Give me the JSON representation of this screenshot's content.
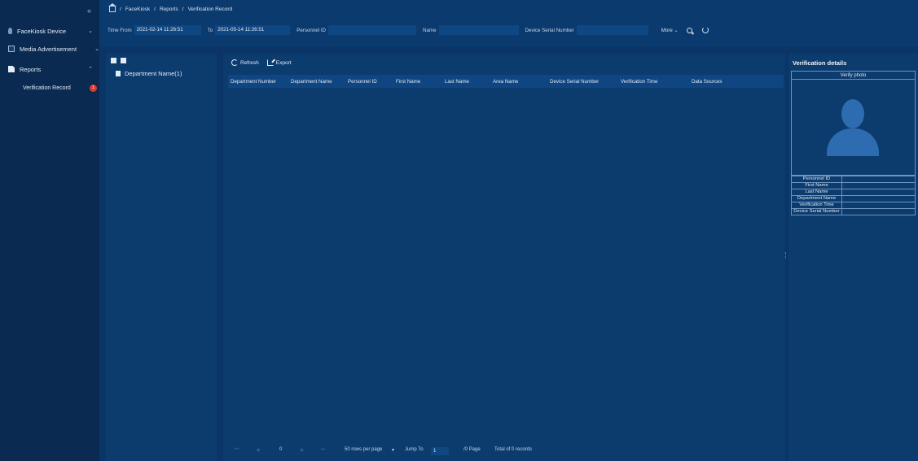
{
  "sidebar": {
    "collapse_glyph": "«",
    "items": [
      {
        "label": "FaceKiosk Device",
        "chevron": "⌄"
      },
      {
        "label": "Media Advertisement",
        "chevron": "⌄"
      },
      {
        "label": "Reports",
        "chevron": "⌃"
      }
    ],
    "sub_item": {
      "label": "Verification Record",
      "badge": "1"
    }
  },
  "breadcrumb": {
    "sep": "/",
    "items": [
      "FaceKiosk",
      "Reports",
      "Verification Record"
    ]
  },
  "filters": {
    "time_from_label": "Time From",
    "time_from_value": "2021-02-14 11:26:51",
    "to_label": "To",
    "to_value": "2021-05-14 11:26:51",
    "personnel_id_label": "Personnel ID",
    "name_label": "Name",
    "device_serial_label": "Device Serial Number",
    "more_label": "More ⌄"
  },
  "dept_tree": {
    "item": "Department Name(1)"
  },
  "toolbar": {
    "refresh_label": "Refresh",
    "export_label": "Export"
  },
  "table": {
    "columns": [
      "Department Number",
      "Department Name",
      "Personnel ID",
      "First Name",
      "Last Name",
      "Area Name",
      "Device Serial Number",
      "Verification Time",
      "Data Sources"
    ],
    "rows": []
  },
  "pager": {
    "page_num": "0",
    "rows_per_page": "50 rows per page",
    "dropdown_glyph": "▾",
    "jump_to_label": "Jump To",
    "jump_value": "1",
    "page_suffix": "/0 Page",
    "total_text": "Total of 0 records"
  },
  "details": {
    "title": "Verification details",
    "photo_label": "Verify photo",
    "fields": [
      "Personnel ID",
      "First Name",
      "Last Name",
      "Department Name",
      "Verification Time",
      "Device Serial Number"
    ]
  }
}
